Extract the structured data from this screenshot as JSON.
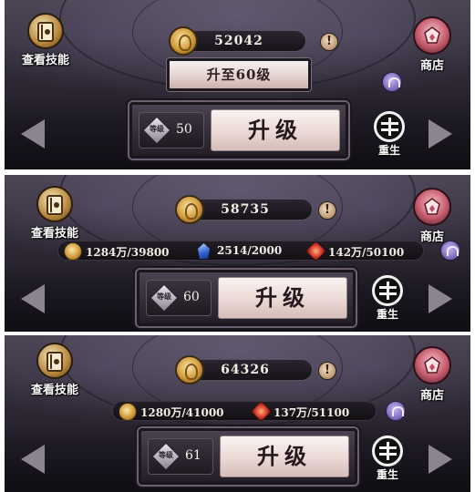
{
  "panels": [
    {
      "skill_label": "查看技能",
      "shop_label": "商店",
      "gold": "52042",
      "alert": "!",
      "goto_label": "升至60级",
      "level_badge": "等级",
      "level": "50",
      "upgrade_label": "升级",
      "rebirth_label": "重生"
    },
    {
      "skill_label": "查看技能",
      "shop_label": "商店",
      "gold": "58735",
      "alert": "!",
      "resources": [
        {
          "icon": "gold-coin-icon",
          "text": "1284万/39800"
        },
        {
          "icon": "blue-crystal-icon",
          "text": "2514/2000"
        },
        {
          "icon": "red-rune-icon",
          "text": "142万/50100"
        }
      ],
      "level_badge": "等级",
      "level": "60",
      "upgrade_label": "升级",
      "rebirth_label": "重生"
    },
    {
      "skill_label": "查看技能",
      "shop_label": "商店",
      "gold": "64326",
      "alert": "!",
      "resources": [
        {
          "icon": "gold-coin-icon",
          "text": "1280万/41000"
        },
        {
          "icon": "red-rune-icon",
          "text": "137万/51100"
        }
      ],
      "level_badge": "等级",
      "level": "61",
      "upgrade_label": "升级",
      "rebirth_label": "重生"
    }
  ]
}
